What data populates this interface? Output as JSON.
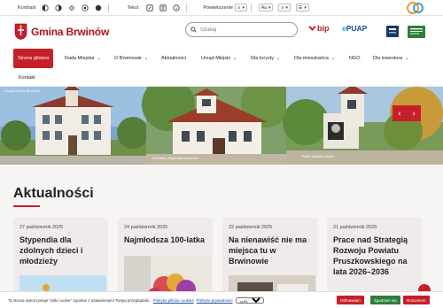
{
  "a11y": {
    "contrast_label": "Kontrast",
    "text_label": "Tekst",
    "zoom_label": "Powiększenie",
    "zoom_value": "100%",
    "font_label": "Aa"
  },
  "header": {
    "logo_text": "Gmina Brwinów",
    "search_placeholder": "Szukaj",
    "bip_label": "bip",
    "epuap_prefix": "e",
    "epuap_label": "PUAP"
  },
  "nav": {
    "items": [
      {
        "label": "Strona główna"
      },
      {
        "label": "Rada Miejska"
      },
      {
        "label": "O Brwinowie"
      },
      {
        "label": "Aktualności"
      },
      {
        "label": "Urząd Miejski"
      },
      {
        "label": "Dla turysty"
      },
      {
        "label": "Dla mieszkańca"
      },
      {
        "label": "NGO"
      },
      {
        "label": "Dla inwestora"
      },
      {
        "label": "Kontakt"
      }
    ]
  },
  "hero": {
    "label_left": "Urząd Gminy Brwinów",
    "label_mid": "Brwinów, Zagrodnie Brwinów",
    "label_right": "Polski Wojtek Klinica",
    "accent": "#c71f2a"
  },
  "news": {
    "heading": "Aktualności",
    "cards": [
      {
        "date": "27 październik 2025",
        "title": "Stypendia dla zdolnych dzieci i młodzieży"
      },
      {
        "date": "24 październik 2025",
        "title": "Najmłodsza 100-latka"
      },
      {
        "date": "22 październik 2025",
        "title": "Na nienawiść nie ma miejsca tu w Brwinowie"
      },
      {
        "date": "21 październik 2025",
        "title": "Prace nad Strategią Rozwoju Powiatu Pruszkowskiego na lata 2026–2036"
      }
    ]
  },
  "cookie": {
    "text": "Ta strona wykorzystuje \"pliki cookie\" zgodnie z ustawieniami Twojej przeglądarki.",
    "policy_link": "Polityka plików cookies",
    "privacy_link": "Polityka prywatności",
    "lang": "pl-PL",
    "btn_reject": "Odmawiam",
    "btn_accept": "Zgadzam się",
    "btn_hide": "Rozumiem"
  },
  "colors": {
    "brand_red": "#c71f2a",
    "card_bg": "#efebea"
  }
}
